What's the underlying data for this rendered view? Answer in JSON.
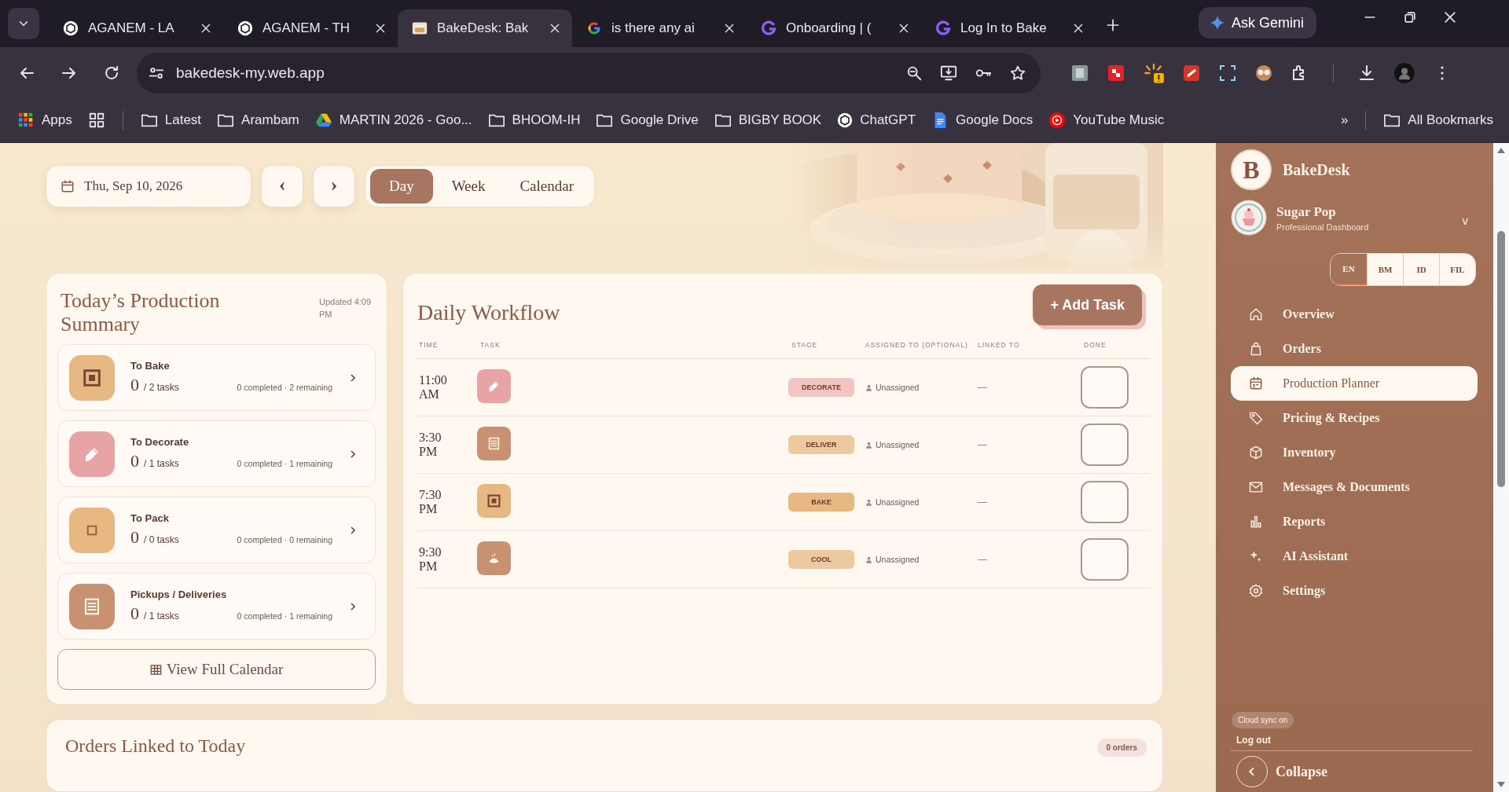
{
  "browser": {
    "tabs": [
      {
        "title": "AGANEM - LA",
        "kind": "chatgpt",
        "selected": false
      },
      {
        "title": "AGANEM - TH",
        "kind": "chatgpt",
        "selected": false
      },
      {
        "title": "BakeDesk: Bak",
        "kind": "bakedesk",
        "selected": true
      },
      {
        "title": "is there any ai",
        "kind": "google",
        "selected": false
      },
      {
        "title": "Onboarding | (",
        "kind": "purple",
        "selected": false
      },
      {
        "title": "Log In to Bake",
        "kind": "purple",
        "selected": false
      }
    ],
    "ask": "Ask Gemini",
    "url": "bakedesk-my.web.app",
    "bookmarks": [
      {
        "label": "Apps",
        "kind": "apps"
      },
      {
        "label": "Latest",
        "kind": "folder"
      },
      {
        "label": "Arambam",
        "kind": "folder"
      },
      {
        "label": "MARTIN 2026 - Goo...",
        "kind": "drive"
      },
      {
        "label": "BHOOM-IH",
        "kind": "folder"
      },
      {
        "label": "Google Drive",
        "kind": "folder"
      },
      {
        "label": "BIGBY BOOK",
        "kind": "folder"
      },
      {
        "label": "ChatGPT",
        "kind": "chatgpt"
      },
      {
        "label": "Google Docs",
        "kind": "docs"
      },
      {
        "label": "YouTube Music",
        "kind": "youtube"
      }
    ],
    "overflow": "»",
    "all_bookmarks": "All Bookmarks"
  },
  "toolbar": {
    "date": "Thu, Sep 10, 2026",
    "prev": "‹",
    "next": "›",
    "view_tabs": [
      {
        "label": "Day",
        "selected": true
      },
      {
        "label": "Week",
        "selected": false
      },
      {
        "label": "Calendar",
        "selected": false
      }
    ]
  },
  "summary": {
    "title": "Today’s Production Summary",
    "updated": "Updated 4:09 PM",
    "items": [
      {
        "kind": "bake",
        "label": "To Bake",
        "count": "0",
        "total": "/ 2 tasks",
        "progress": "0 completed · 2 remaining"
      },
      {
        "kind": "decorate",
        "label": "To Decorate",
        "count": "0",
        "total": "/ 1 tasks",
        "progress": "0 completed · 1 remaining"
      },
      {
        "kind": "pack",
        "label": "To Pack",
        "count": "0",
        "total": "/ 0 tasks",
        "progress": "0 completed · 0 remaining"
      },
      {
        "kind": "deliver",
        "label": "Pickups / Deliveries",
        "count": "0",
        "total": "/ 1 tasks",
        "progress": "0 completed · 1 remaining"
      }
    ],
    "button": "View Full Calendar"
  },
  "workflow": {
    "title": "Daily Workflow",
    "add_button": "+ Add Task",
    "columns": [
      "TIME",
      "TASK",
      "STAGE",
      "ASSIGNED TO (OPTIONAL)",
      "LINKED TO",
      "DONE"
    ],
    "rows": [
      {
        "time": "11:00 AM",
        "kind": "decorate",
        "stage": "DECORATE",
        "assigned": "Unassigned",
        "linked": "—",
        "done": false
      },
      {
        "time": "3:30 PM",
        "kind": "deliver",
        "stage": "DELIVER",
        "assigned": "Unassigned",
        "linked": "—",
        "done": false
      },
      {
        "time": "7:30 PM",
        "kind": "bake",
        "stage": "BAKE",
        "assigned": "Unassigned",
        "linked": "—",
        "done": false
      },
      {
        "time": "9:30 PM",
        "kind": "cool",
        "stage": "COOL",
        "assigned": "Unassigned",
        "linked": "—",
        "done": false
      }
    ]
  },
  "orders": {
    "title": "Orders Linked to Today",
    "badge": "0 orders"
  },
  "sidebar": {
    "logo": "B",
    "brand": "BakeDesk",
    "profile": "Sugar Pop",
    "subtitle": "Professional Dashboard",
    "chevron": "v",
    "languages": [
      {
        "label": "EN",
        "selected": true
      },
      {
        "label": "BM",
        "selected": false
      },
      {
        "label": "ID",
        "selected": false
      },
      {
        "label": "FIL",
        "selected": false
      }
    ],
    "nav": [
      {
        "label": "Overview",
        "kind": "home",
        "selected": false
      },
      {
        "label": "Orders",
        "kind": "bag",
        "selected": false
      },
      {
        "label": "Production Planner",
        "kind": "calendar",
        "selected": true
      },
      {
        "label": "Pricing & Recipes",
        "kind": "tag",
        "selected": false
      },
      {
        "label": "Inventory",
        "kind": "box",
        "selected": false
      },
      {
        "label": "Messages & Documents",
        "kind": "mail",
        "selected": false
      },
      {
        "label": "Reports",
        "kind": "chart",
        "selected": false
      },
      {
        "label": "AI Assistant",
        "kind": "sparkle",
        "selected": false
      },
      {
        "label": "Settings",
        "kind": "gear",
        "selected": false
      }
    ],
    "sync": "Cloud sync on",
    "logout": "Log out",
    "collapse": "Collapse"
  }
}
